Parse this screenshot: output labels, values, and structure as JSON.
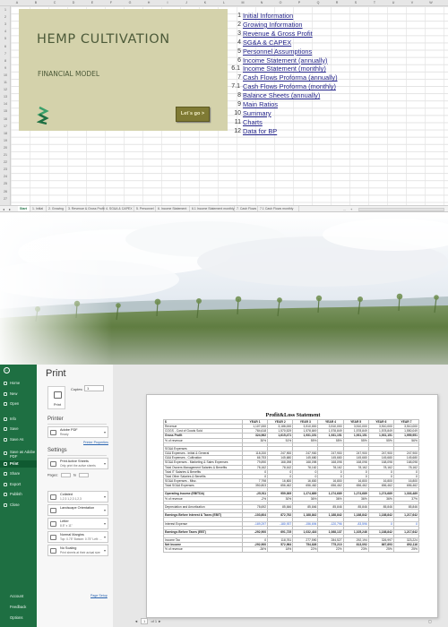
{
  "sheet": {
    "columns": [
      "A",
      "B",
      "C",
      "D",
      "E",
      "F",
      "G",
      "H",
      "I",
      "J",
      "K",
      "L",
      "M",
      "N",
      "O",
      "P",
      "Q",
      "R",
      "S",
      "T",
      "U",
      "V",
      "W",
      "X"
    ],
    "rows": [
      "1",
      "2",
      "3",
      "4",
      "5",
      "6",
      "7",
      "8",
      "9",
      "10",
      "11",
      "12",
      "13",
      "14",
      "15",
      "16",
      "17",
      "18",
      "19",
      "20",
      "21",
      "22",
      "23",
      "24",
      "25",
      "26",
      "27"
    ],
    "banner": {
      "title": "HEMP CULTIVATION",
      "subtitle": "FINANCIAL MODEL",
      "go_button": "Let´s go >"
    },
    "toc": [
      {
        "num": "1",
        "label": "Initial Information"
      },
      {
        "num": "2",
        "label": "Growing Information"
      },
      {
        "num": "3",
        "label": "Revenue & Gross Profit"
      },
      {
        "num": "4",
        "label": "SG&A & CAPEX"
      },
      {
        "num": "5",
        "label": "Personnel Assumptions"
      },
      {
        "num": "6",
        "label": "Income Statement (annually)"
      },
      {
        "num": "6.1",
        "label": "Income Statement (monthly)"
      },
      {
        "num": "7",
        "label": "Cash Flows Proforma (annually)"
      },
      {
        "num": "7.1",
        "label": "Cash Flows Proforma (monthly)"
      },
      {
        "num": "8",
        "label": "Balance Sheets (annually)"
      },
      {
        "num": "9",
        "label": "Main Ratios"
      },
      {
        "num": "10",
        "label": "Summary"
      },
      {
        "num": "11",
        "label": "Charts"
      },
      {
        "num": "12",
        "label": "Data for BP"
      }
    ],
    "tabs": [
      "Start",
      "1. Initial",
      "2. Growing",
      "3. Revenue & Gross Profit",
      "4. SG&A & CAPEX",
      "5. Personnel",
      "6. Income Statement",
      "6.1 Income Statement monthly",
      "7. Cash Flows",
      "7.1 Cash Flows monthly"
    ],
    "tab_more": "...",
    "tab_add": "+"
  },
  "backstage": {
    "nav": {
      "back": "←",
      "top": [
        "Home",
        "New",
        "Open",
        "Info",
        "Save",
        "Save As",
        "Save as Adobe PDF",
        "Print",
        "Share",
        "Export",
        "Publish",
        "Close"
      ],
      "bottom": [
        "Account",
        "Feedback",
        "Options"
      ],
      "selected": "Print"
    },
    "title": "Print",
    "print_button": "Print",
    "copies_label": "Copies:",
    "copies_value": "1",
    "printer_heading": "Printer",
    "printer": {
      "name": "Adobe PDF",
      "status": "Ready"
    },
    "printer_properties": "Printer Properties",
    "settings_heading": "Settings",
    "settings": [
      {
        "t1": "Print Active Sheets",
        "t2": "Only print the active sheets"
      },
      {
        "t1": "Collated",
        "t2": "1,2,3   1,2,3   1,2,3"
      },
      {
        "t1": "Landscape Orientation",
        "t2": ""
      },
      {
        "t1": "Letter",
        "t2": "8.5\" x 11\""
      },
      {
        "t1": "Normal Margins",
        "t2": "Top: 0.75\" Bottom: 0.75\" Left: ..."
      },
      {
        "t1": "No Scaling",
        "t2": "Print sheets at their actual size"
      }
    ],
    "pages_label": "Pages:",
    "pages_to": "to",
    "page_setup": "Page Setup",
    "pager": {
      "prev": "◄",
      "current": "1",
      "of": "of 1",
      "next": "►"
    },
    "zoom_icon": "zoom-to-page-icon"
  },
  "pl": {
    "title": "Profit&Loss Statement",
    "header": [
      "$",
      "YEAR 1",
      "YEAR 2",
      "YEAR 3",
      "YEAR 4",
      "YEAR 5",
      "YEAR 6",
      "YEAR 7"
    ],
    "rows": [
      {
        "style": "",
        "cells": [
          "Revenue",
          "1,107,000",
          "3,186,000",
          "3,510,000",
          "3,510,000",
          "3,510,000",
          "3,510,000",
          "3,510,000"
        ]
      },
      {
        "style": "",
        "cells": [
          "   COGS - Cost of Goods Sold",
          "784,618",
          "1,570,529",
          "1,578,849",
          "1,578,849",
          "1,578,849",
          "1,578,849",
          "1,550,049"
        ]
      },
      {
        "style": "b",
        "cells": [
          "Gross Profit",
          "324,962",
          "1,615,471",
          "1,931,151",
          "1,931,151",
          "1,931,151",
          "1,931,151",
          "1,959,951"
        ]
      },
      {
        "style": "",
        "cells": [
          "% of revenue",
          "30%",
          "51%",
          "55%",
          "55%",
          "55%",
          "55%",
          "56%"
        ]
      },
      {
        "style": "sp",
        "cells": [
          "",
          "",
          "",
          "",
          "",
          "",
          "",
          ""
        ]
      },
      {
        "style": "",
        "cells": [
          "SG&A Expenses",
          "",
          "",
          "",
          "",
          "",
          "",
          ""
        ]
      },
      {
        "style": "",
        "cells": [
          "   G&A Expenses - Initial & General",
          "118,200",
          "247,900",
          "247,900",
          "247,900",
          "247,900",
          "247,900",
          "247,900"
        ]
      },
      {
        "style": "",
        "cells": [
          "   G&A Expenses - Cultivation",
          "66,753",
          "145,680",
          "145,680",
          "145,680",
          "145,680",
          "145,680",
          "145,680"
        ]
      },
      {
        "style": "",
        "cells": [
          "   SG&A Expenses - Marketing & Sales Expenses",
          "79,890",
          "168,098",
          "168,098",
          "168,098",
          "168,098",
          "168,098",
          "168,098"
        ]
      },
      {
        "style": "",
        "cells": [
          "   Total Owners Management Salaries & Benefits",
          "78,162",
          "78,162",
          "78,162",
          "78,162",
          "78,162",
          "78,162",
          "78,162"
        ]
      },
      {
        "style": "",
        "cells": [
          "   Total IT Salaries & Benefits",
          "0",
          "0",
          "0",
          "0",
          "0",
          "0",
          "0"
        ]
      },
      {
        "style": "",
        "cells": [
          "   Total Other Salaries & Benefits",
          "0",
          "0",
          "0",
          "0",
          "0",
          "0",
          "0"
        ]
      },
      {
        "style": "",
        "cells": [
          "   SG&A Expenses - Misc.",
          "7,798",
          "16,800",
          "16,800",
          "16,800",
          "16,800",
          "16,800",
          "16,800"
        ]
      },
      {
        "style": "",
        "cells": [
          "   Total SG&A Expenses",
          "350,803",
          "656,462",
          "656,462",
          "656,462",
          "656,462",
          "656,462",
          "656,462"
        ]
      },
      {
        "style": "sp",
        "cells": [
          "",
          "",
          "",
          "",
          "",
          "",
          "",
          ""
        ]
      },
      {
        "style": "b",
        "cells": [
          "Operating Income (EBITDA)",
          "-25,911",
          "959,009",
          "1,274,689",
          "1,274,689",
          "1,274,689",
          "1,274,689",
          "1,303,489"
        ]
      },
      {
        "style": "",
        "cells": [
          "% of revenue",
          "-2%",
          "30%",
          "36%",
          "36%",
          "36%",
          "36%",
          "37%"
        ]
      },
      {
        "style": "sp",
        "cells": [
          "",
          "",
          "",
          "",
          "",
          "",
          "",
          ""
        ]
      },
      {
        "style": "",
        "cells": [
          "Depreciation and Amortization",
          "78,692",
          "85,846",
          "85,846",
          "85,846",
          "85,846",
          "85,846",
          "85,846"
        ]
      },
      {
        "style": "sp",
        "cells": [
          "",
          "",
          "",
          "",
          "",
          "",
          "",
          ""
        ]
      },
      {
        "style": "b",
        "cells": [
          "Earnings Before Interest & Taxes (EBIT)",
          "-103,604",
          "872,762",
          "1,188,842",
          "1,188,842",
          "1,188,842",
          "1,188,842",
          "1,217,642"
        ]
      },
      {
        "style": "sp",
        "cells": [
          "",
          "",
          "",
          "",
          "",
          "",
          "",
          ""
        ]
      },
      {
        "style": "blue",
        "cells": [
          "Interest Expense",
          "-189,297",
          "-180,937",
          "-156,694",
          "-120,796",
          "-83,596",
          "0",
          "0"
        ]
      },
      {
        "style": "sp",
        "cells": [
          "",
          "",
          "",
          "",
          "",
          "",
          "",
          ""
        ]
      },
      {
        "style": "b",
        "cells": [
          "Earnings Before Taxes (EBT)",
          "-292,900",
          "691,725",
          "1,032,416",
          "1,068,137",
          "1,105,246",
          "1,188,842",
          "1,217,642"
        ]
      },
      {
        "style": "sp",
        "cells": [
          "",
          "",
          "",
          "",
          "",
          "",
          "",
          ""
        ]
      },
      {
        "style": "",
        "cells": [
          "Income Tax",
          "0",
          "118,761",
          "277,590",
          "284,527",
          "292,194",
          "326,997",
          "323,224"
        ]
      },
      {
        "style": "b",
        "cells": [
          "Net Income",
          "-292,900",
          "572,964",
          "754,826",
          "775,210",
          "813,092",
          "867,893",
          "892,116"
        ]
      },
      {
        "style": "",
        "cells": [
          "% of revenue",
          "-26%",
          "18%",
          "22%",
          "22%",
          "23%",
          "25%",
          "25%"
        ]
      }
    ]
  },
  "colors": {
    "excel_green": "#217346",
    "banner_bg": "#d4d2ab",
    "banner_text": "#4c5a39",
    "button_bg": "#7f7a34",
    "link": "#23238a",
    "backstage_nav": "#1e6f42"
  }
}
